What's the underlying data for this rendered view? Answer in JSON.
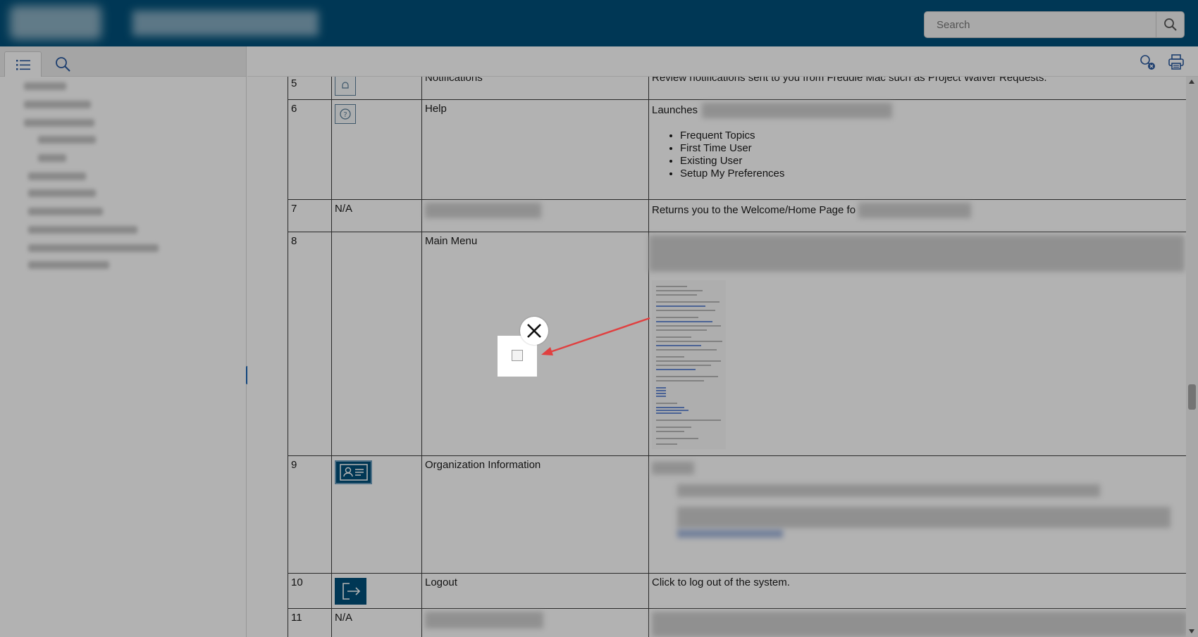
{
  "search": {
    "placeholder": "Search"
  },
  "table": {
    "row5": {
      "num": "5",
      "label": "Notifications",
      "desc": "Review notifications sent to you from Freddie Mac such as Project Waiver Requests."
    },
    "row6": {
      "num": "6",
      "label": "Help",
      "desc_prefix": "Launches",
      "items": [
        "Frequent Topics",
        "First Time User",
        "Existing User",
        "Setup My Preferences"
      ]
    },
    "row7": {
      "num": "7",
      "icon_text": "N/A",
      "desc_prefix": "Returns you to the Welcome/Home Page fo"
    },
    "row8": {
      "num": "8",
      "label": "Main Menu"
    },
    "row9": {
      "num": "9",
      "label": "Organization Information"
    },
    "row10": {
      "num": "10",
      "label": "Logout",
      "desc": "Click to log out of the system."
    },
    "row11": {
      "num": "11",
      "icon_text": "N/A"
    }
  },
  "colors": {
    "header": "#00507a",
    "accent": "#1a63b4",
    "arrow": "#e04040"
  },
  "icons": {
    "search": "search-icon",
    "toc": "list-icon",
    "clear": "clear-highlight-icon",
    "print": "printer-icon",
    "close": "close-icon"
  }
}
